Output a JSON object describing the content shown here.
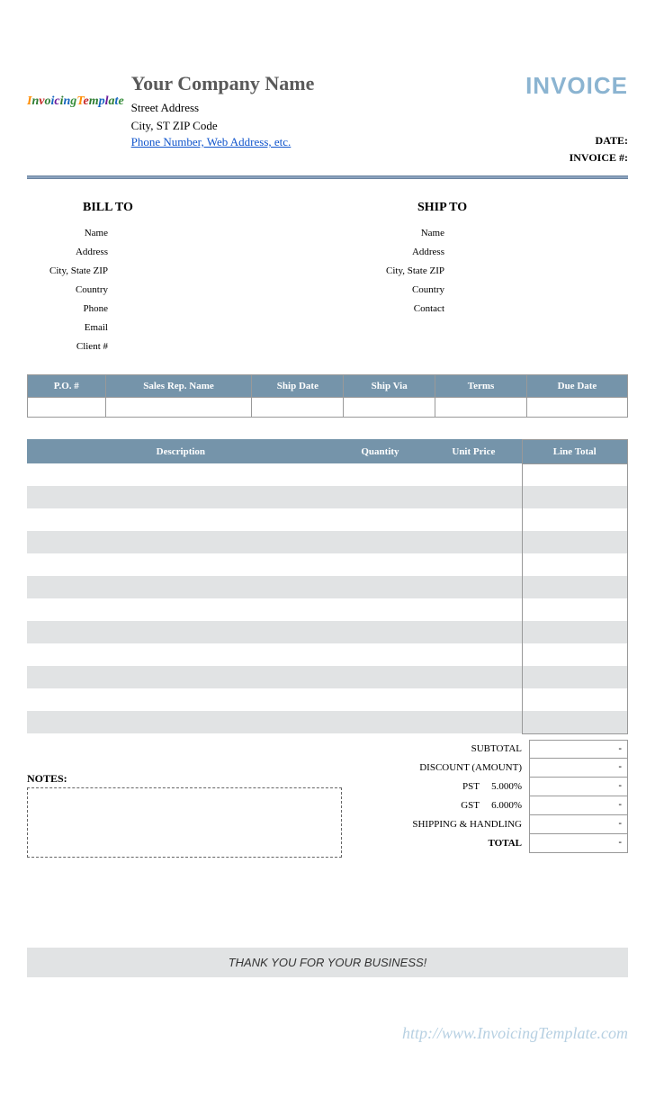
{
  "logo_text": "InvoicingTemplate",
  "company": {
    "name": "Your Company Name",
    "street": "Street Address",
    "city_line": "City, ST  ZIP Code",
    "contact_link": "Phone Number, Web Address, etc."
  },
  "title": "INVOICE",
  "meta": {
    "date_label": "DATE:",
    "invoice_no_label": "INVOICE #:"
  },
  "bill_to": {
    "heading": "BILL TO",
    "labels": [
      "Name",
      "Address",
      "City, State ZIP",
      "Country",
      "Phone",
      "Email",
      "Client #"
    ]
  },
  "ship_to": {
    "heading": "SHIP TO",
    "labels": [
      "Name",
      "Address",
      "City, State ZIP",
      "Country",
      "Contact"
    ]
  },
  "info_headers": {
    "po": "P.O. #",
    "rep": "Sales Rep. Name",
    "ship_date": "Ship Date",
    "ship_via": "Ship Via",
    "terms": "Terms",
    "due": "Due Date"
  },
  "item_headers": {
    "description": "Description",
    "quantity": "Quantity",
    "unit_price": "Unit Price",
    "line_total": "Line Total"
  },
  "notes_label": "NOTES:",
  "summary": {
    "subtotal": "SUBTOTAL",
    "discount": "DISCOUNT (AMOUNT)",
    "pst": "PST",
    "pst_rate": "5.000%",
    "gst": "GST",
    "gst_rate": "6.000%",
    "shipping": "SHIPPING & HANDLING",
    "total": "TOTAL",
    "dash": "-"
  },
  "thanks": "THANK YOU FOR YOUR BUSINESS!",
  "watermark": "http://www.InvoicingTemplate.com"
}
